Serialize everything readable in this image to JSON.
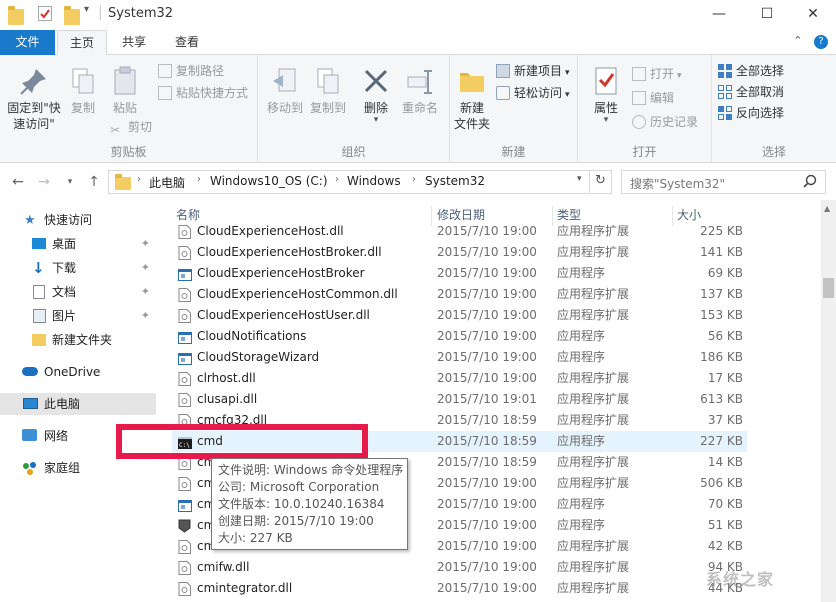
{
  "window": {
    "title": "System32",
    "controls": {
      "minimize": "—",
      "maximize": "☐",
      "close": "✕"
    }
  },
  "ribbon": {
    "tabs": [
      {
        "label": "文件"
      },
      {
        "label": "主页"
      },
      {
        "label": "共享"
      },
      {
        "label": "查看"
      }
    ],
    "groups": {
      "clipboard": {
        "label": "剪贴板",
        "pin": "固定到\"快\n速访问\"",
        "copy": "复制",
        "paste": "粘贴",
        "copy_path": "复制路径",
        "paste_shortcut": "粘贴快捷方式",
        "cut": "剪切"
      },
      "organize": {
        "label": "组织",
        "move_to": "移动到",
        "copy_to": "复制到",
        "delete": "删除",
        "rename": "重命名"
      },
      "new": {
        "label": "新建",
        "new_folder": "新建\n文件夹",
        "new_item": "新建项目",
        "easy_access": "轻松访问"
      },
      "open": {
        "label": "打开",
        "properties": "属性",
        "open": "打开",
        "edit": "编辑",
        "history": "历史记录"
      },
      "select": {
        "label": "选择",
        "select_all": "全部选择",
        "select_none": "全部取消",
        "invert": "反向选择"
      }
    }
  },
  "address": {
    "crumbs": [
      "此电脑",
      "Windows10_OS (C:)",
      "Windows",
      "System32"
    ],
    "search_placeholder": "搜索\"System32\""
  },
  "navpane": {
    "items": [
      {
        "label": "快速访问",
        "icon": "star-icon"
      },
      {
        "label": "桌面",
        "icon": "desktop-icon",
        "pinned": true
      },
      {
        "label": "下载",
        "icon": "download-icon",
        "pinned": true
      },
      {
        "label": "文档",
        "icon": "document-icon",
        "pinned": true
      },
      {
        "label": "图片",
        "icon": "picture-icon",
        "pinned": true
      },
      {
        "label": "新建文件夹",
        "icon": "folder-icon"
      },
      {
        "label": "OneDrive",
        "icon": "cloud-icon"
      },
      {
        "label": "此电脑",
        "icon": "computer-icon",
        "selected": true
      },
      {
        "label": "网络",
        "icon": "network-icon"
      },
      {
        "label": "家庭组",
        "icon": "homegroup-icon"
      }
    ]
  },
  "filelist": {
    "headers": {
      "name": "名称",
      "date": "修改日期",
      "type": "类型",
      "size": "大小"
    },
    "rows": [
      {
        "name": "CloudExperienceHost.dll",
        "date": "2015/7/10 19:00",
        "type": "应用程序扩展",
        "size": "225 KB",
        "icon": "dll"
      },
      {
        "name": "CloudExperienceHostBroker.dll",
        "date": "2015/7/10 19:00",
        "type": "应用程序扩展",
        "size": "141 KB",
        "icon": "dll"
      },
      {
        "name": "CloudExperienceHostBroker",
        "date": "2015/7/10 19:00",
        "type": "应用程序",
        "size": "69 KB",
        "icon": "exe"
      },
      {
        "name": "CloudExperienceHostCommon.dll",
        "date": "2015/7/10 19:00",
        "type": "应用程序扩展",
        "size": "137 KB",
        "icon": "dll"
      },
      {
        "name": "CloudExperienceHostUser.dll",
        "date": "2015/7/10 19:00",
        "type": "应用程序扩展",
        "size": "153 KB",
        "icon": "dll"
      },
      {
        "name": "CloudNotifications",
        "date": "2015/7/10 19:00",
        "type": "应用程序",
        "size": "56 KB",
        "icon": "exe"
      },
      {
        "name": "CloudStorageWizard",
        "date": "2015/7/10 19:00",
        "type": "应用程序",
        "size": "186 KB",
        "icon": "exe"
      },
      {
        "name": "clrhost.dll",
        "date": "2015/7/10 19:00",
        "type": "应用程序扩展",
        "size": "17 KB",
        "icon": "dll"
      },
      {
        "name": "clusapi.dll",
        "date": "2015/7/10 19:01",
        "type": "应用程序扩展",
        "size": "613 KB",
        "icon": "dll"
      },
      {
        "name": "cmcfg32.dll",
        "date": "2015/7/10 18:59",
        "type": "应用程序扩展",
        "size": "37 KB",
        "icon": "dll"
      },
      {
        "name": "cmd",
        "date": "2015/7/10 18:59",
        "type": "应用程序",
        "size": "227 KB",
        "icon": "cmd",
        "hover": true
      },
      {
        "name": "cm",
        "date": "2015/7/10 18:59",
        "type": "应用程序扩展",
        "size": "14 KB",
        "icon": "dll"
      },
      {
        "name": "cm",
        "date": "2015/7/10 19:00",
        "type": "应用程序扩展",
        "size": "506 KB",
        "icon": "dll"
      },
      {
        "name": "cm",
        "date": "2015/7/10 19:00",
        "type": "应用程序",
        "size": "70 KB",
        "icon": "exe"
      },
      {
        "name": "cm",
        "date": "2015/7/10 19:00",
        "type": "应用程序",
        "size": "51 KB",
        "icon": "exe2"
      },
      {
        "name": "cm",
        "date": "2015/7/10 19:00",
        "type": "应用程序扩展",
        "size": "42 KB",
        "icon": "dll"
      },
      {
        "name": "cmifw.dll",
        "date": "2015/7/10 19:00",
        "type": "应用程序扩展",
        "size": "94 KB",
        "icon": "dll"
      },
      {
        "name": "cmintegrator.dll",
        "date": "2015/7/10 19:00",
        "type": "应用程序扩展",
        "size": "44 KB",
        "icon": "dll"
      }
    ]
  },
  "tooltip": {
    "lines": [
      "文件说明: Windows 命令处理程序",
      "公司: Microsoft Corporation",
      "文件版本: 10.0.10240.16384",
      "创建日期: 2015/7/10 19:00",
      "大小: 227 KB"
    ]
  },
  "watermark": "系统之家"
}
